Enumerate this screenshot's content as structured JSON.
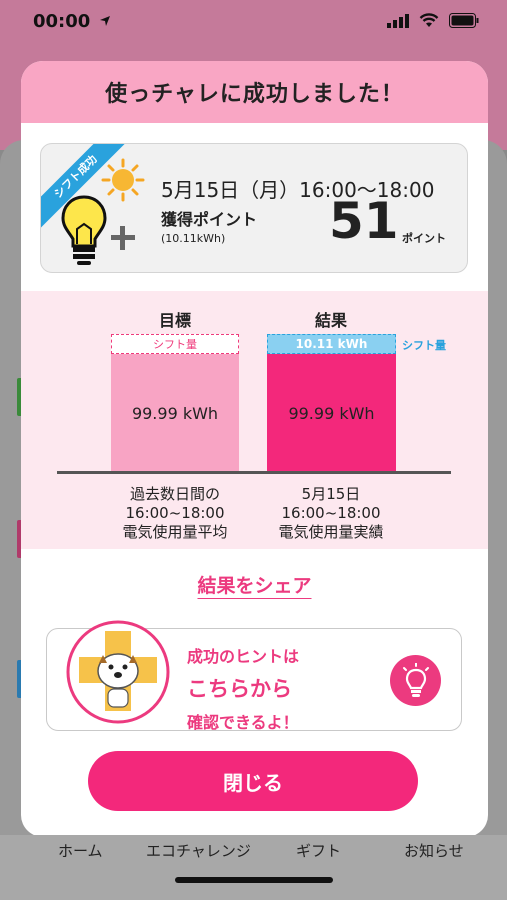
{
  "status_bar": {
    "time": "00:00"
  },
  "modal": {
    "title": "使っチャレに成功しました！",
    "point_card": {
      "ribbon": "シフト成功",
      "date_time": "5月15日（月）16:00〜18:00",
      "label": "獲得ポイント",
      "kwh_note": "(10.11kWh)",
      "points": "51",
      "points_unit": "ポイント"
    },
    "chart": {
      "target_heading": "目標",
      "result_heading": "結果",
      "target_shift_label": "シフト量",
      "result_shift_value": "10.11 kWh",
      "result_shift_side_label": "シフト量",
      "target_value": "99.99 kWh",
      "result_value": "99.99 kWh",
      "target_caption": [
        "過去数日間の",
        "16:00~18:00",
        "電気使用量平均"
      ],
      "result_caption": [
        "5月15日",
        "16:00~18:00",
        "電気使用量実績"
      ]
    },
    "share_label": "結果をシェア",
    "hint": {
      "line1": "成功のヒントは",
      "line2": "こちらから",
      "line3": "確認できるよ！"
    },
    "close_label": "閉じる"
  },
  "tabbar": {
    "items": [
      "ホーム",
      "エコチャレンジ",
      "ギフト",
      "お知らせ"
    ]
  },
  "colors": {
    "accent_pink": "#f3287b",
    "header_pink": "#f9a6c4",
    "light_pink": "#f8a4c4",
    "blue": "#2aa2dd"
  }
}
